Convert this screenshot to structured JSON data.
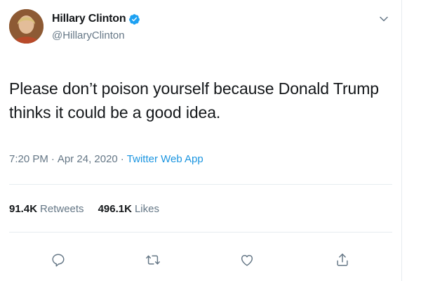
{
  "tweet": {
    "author": {
      "display_name": "Hillary Clinton",
      "handle": "@HillaryClinton",
      "verified": true
    },
    "text": "Please don’t poison yourself because Donald Trump thinks it could be a good idea.",
    "time": "7:20 PM",
    "date": "Apr 24, 2020",
    "separator": "·",
    "source": "Twitter Web App",
    "stats": {
      "retweets_count": "91.4K",
      "retweets_label": "Retweets",
      "likes_count": "496.1K",
      "likes_label": "Likes"
    },
    "actions": [
      "reply-icon",
      "retweet-icon",
      "like-icon",
      "share-icon"
    ]
  },
  "colors": {
    "text": "#14171a",
    "secondary": "#657786",
    "link": "#1b95e0",
    "verified": "#1da1f2",
    "divider": "#e6ecf0"
  }
}
